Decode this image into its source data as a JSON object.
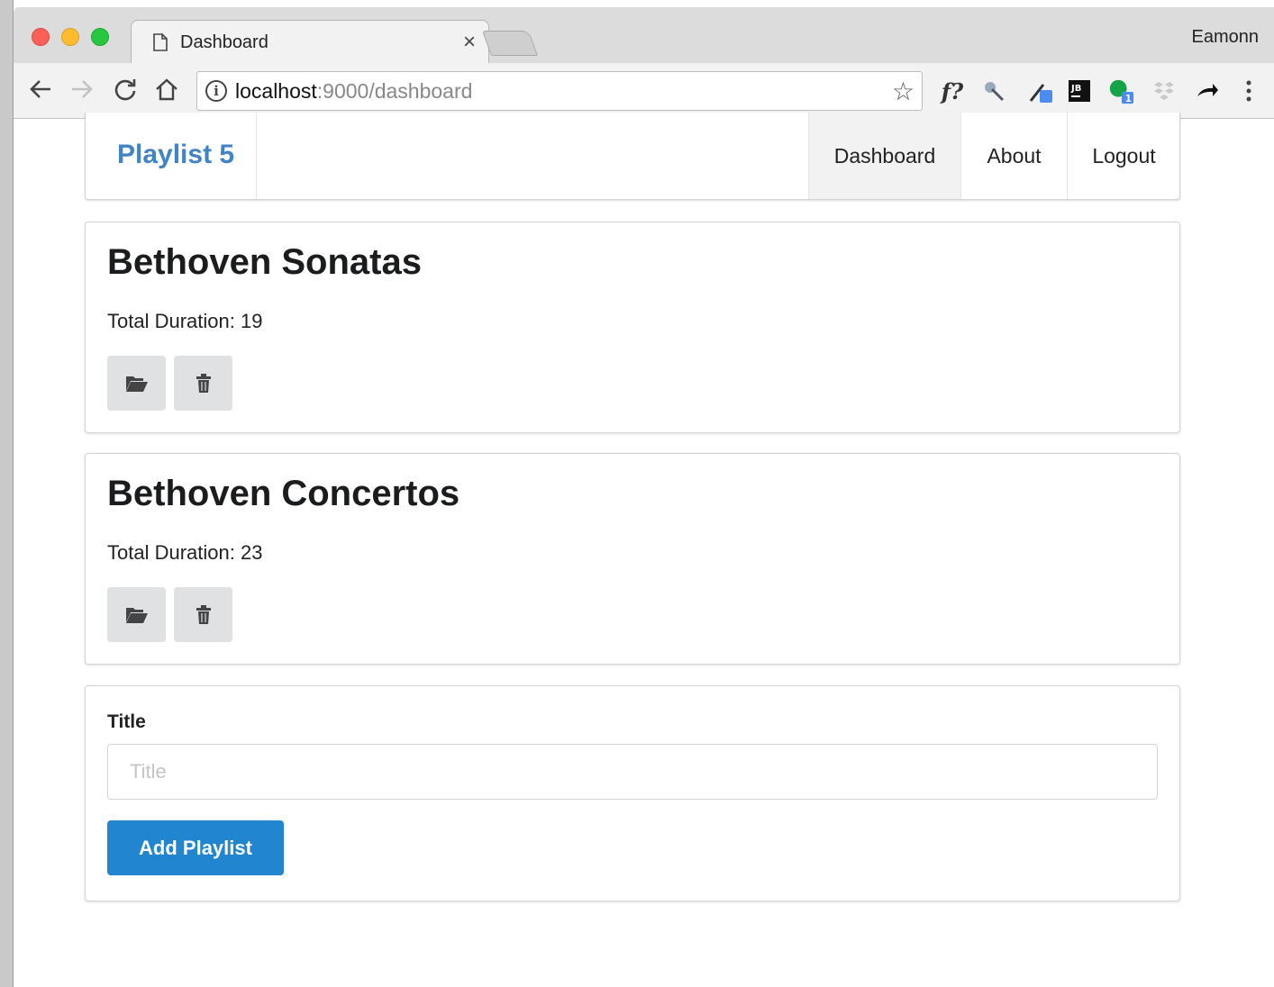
{
  "browser": {
    "tab_title": "Dashboard",
    "tab_close": "×",
    "user": "Eamonn",
    "url_host": "localhost",
    "url_rest": ":9000/dashboard"
  },
  "nav": {
    "brand": "Playlist 5",
    "items": [
      {
        "label": "Dashboard",
        "active": true
      },
      {
        "label": "About"
      },
      {
        "label": "Logout"
      }
    ]
  },
  "playlists": [
    {
      "title": "Bethoven Sonatas",
      "duration": "Total Duration: 19"
    },
    {
      "title": "Bethoven Concertos",
      "duration": "Total Duration: 23"
    }
  ],
  "form": {
    "label": "Title",
    "placeholder": "Title",
    "value": "",
    "submit_label": "Add Playlist"
  },
  "colors": {
    "brand": "#4183c4",
    "primary_button": "#2185d0",
    "icon_button": "#e0e1e2"
  },
  "icons": {
    "playlist_open": "folder-open-icon",
    "playlist_delete": "trash-icon"
  }
}
